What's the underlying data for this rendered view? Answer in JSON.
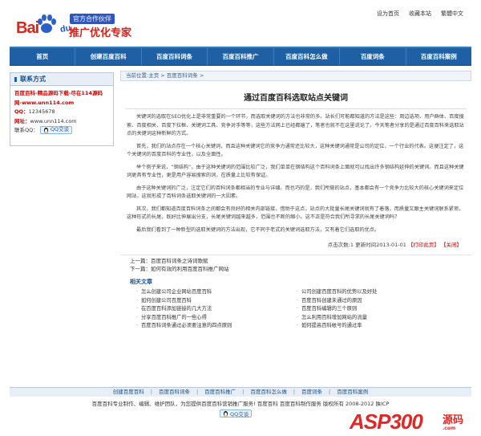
{
  "header": {
    "logo_text": "Bai",
    "logo_du": "du",
    "partner_badge": "官方合作伙伴",
    "slogan": "推广优化专家",
    "top_links": [
      "设为首页",
      "收藏本站",
      "繁體中文"
    ]
  },
  "nav": {
    "items": [
      "首页",
      "创建百度百科",
      "百度百科词条",
      "百度百科推广",
      "百度百科怎么做",
      "百度词条",
      "百度百科案例"
    ]
  },
  "sidebar": {
    "title": "联系方式",
    "promo_line": "百度百科-精品源码下载-尽在114源码网-www.unn114.com",
    "qq_label": "QQ：",
    "qq_value": "12345678",
    "site_label": "网址：",
    "site_value": "www.unn114.com",
    "contact_qq_label": "联系QQ：",
    "qq_button": "QQ交谈"
  },
  "content": {
    "breadcrumb": "当前位置:主页 > 百度百科词条 >",
    "article_title": "通过百度百科选取站点关键词",
    "paragraphs": [
      "关键词的选取在SEO优化上是非常重要的一个环节，而选取关键词的方法也非常的多。站长们可能都知道的方法是这些：周边选项、用户群体、百度搜索、百度相关、百度下拉框、关键词工具、竞争对手等等，这些方法网上已经都遍了，笔者也就不在这里说论了。今天笔者分享的是通过百度百科来选取站点的关键词这种新鲜的方式。",
      "首先，我们的站点存在一个核心关键词，而且这种关键词它的竞争力通常还比较大，这种关键词通常是公司的定位，一个行业的代表。这便注定了，这个关键词的百度百科的专业性，以及全面性。",
      "举个例子来说，“钢结构”，由于这种关键词的范围比较广泛，我们单单在钢结构这个百科词条上面就可以找出许多钢结构延伸的关键词。而且这种关键词更具有专业性，更是用户容易搜索的词，在质量上比较有保证。",
      "由于这种关键词的广泛，注定它们的百科词条都相当的专业与详细。而也巧的是，我们所做的站点，基本都会有一个竞争力比较大的核心关键词来定位网站，这就形成了百科词条选取关键词的一大因素。",
      "其次，我们都知道百度百科词条之间都会有良好的相关内部链接，借助于这点，站点的大批量长尾关键词就有了着落，而质量又跟主关键词联系紧密。这种形式的长尾，既好比伸展出分支，长尾关键词越来越多，范围也不断的缩小。这不正是符合我们所寻求的长尾关键词吗？",
      "最后我们看到了一种新型的选取关键词的方法出现，它不同于老式的关键词选取方法，又有着它们选取的优点。"
    ],
    "meta_views": "点击次数:1",
    "meta_updated": "更新时间2013-01-01",
    "meta_print": "【打印此页】",
    "meta_close": "【关闭】",
    "prev": "上一篇：百度百科词条之诗词歌赋",
    "next": "下一篇：如何有效的利用百度百科推广网站",
    "related_title": "相关文章",
    "related": [
      "怎么创建公司企业网站百度百科",
      "公司创建百度百科的优势以及好处",
      "如何创建公司百度百科",
      "百度百科创建未通过的原因",
      "在百度百科添加链接的几大方法",
      "百度百科编辑的三个原则",
      "分享百度百科推广的一些心得",
      "怎么利用百科增加网站的流量",
      "百度百科词条通过必须要注意的四点原则",
      "如何提高百科帐号的通过率"
    ]
  },
  "footer": {
    "nav": [
      "创建百度百科",
      "百度百科词条",
      "百度百科推广",
      "百度百科怎么做",
      "百度词条",
      "百度百科案例"
    ],
    "copyright": "百度百科专业制作、编辑、维护团队，为您提供百度百科营销推广服务! 百度百科 百度百科制作服务 版权所有 2008-2012 陕ICP",
    "qq_button": "QQ交谈"
  },
  "watermark": {
    "asp": "ASP300",
    "ym": "源码",
    "com": ".com"
  },
  "colors": {
    "nav_bg": "#1f5fa4",
    "accent_red": "#d30000",
    "link_blue": "#1b4f8f"
  }
}
